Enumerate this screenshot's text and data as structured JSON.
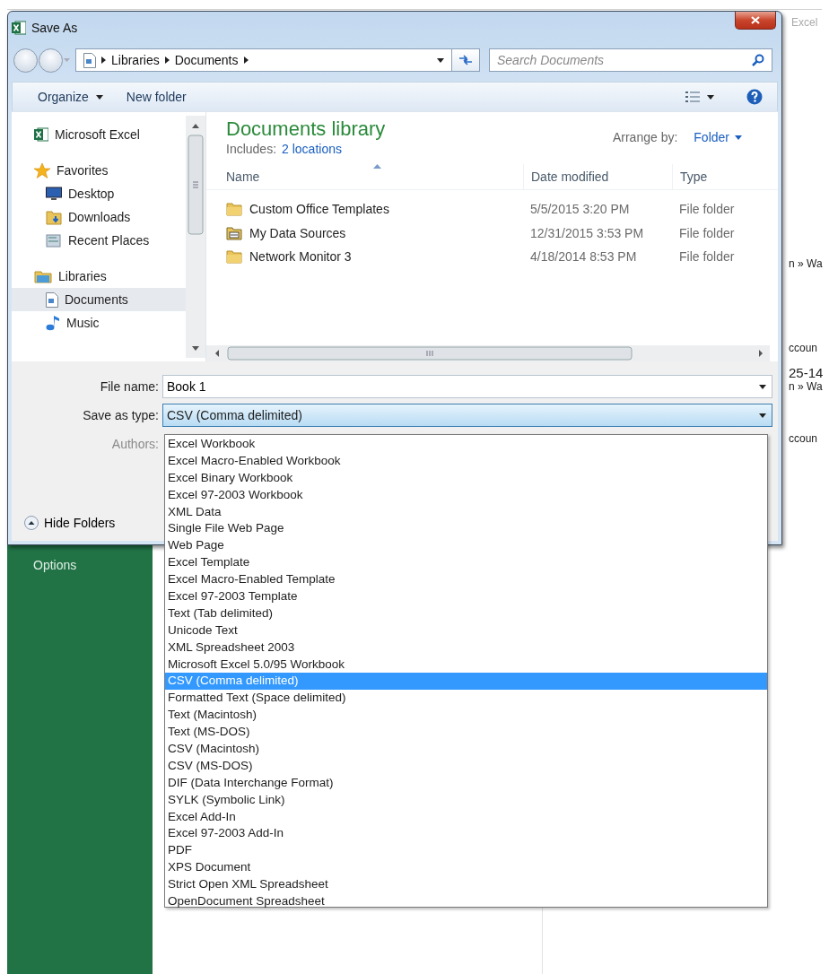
{
  "background": {
    "title_fragment": "Excel",
    "sidebar_items": [
      "Options"
    ],
    "fragments": [
      {
        "text": "n » Wa",
        "kind": "small"
      },
      {
        "text": "ccoun",
        "kind": "small"
      },
      {
        "text": "25-14",
        "kind": "large"
      },
      {
        "text": "n » Wa",
        "kind": "small"
      },
      {
        "text": "ccoun",
        "kind": "small"
      }
    ]
  },
  "dialog": {
    "title": "Save As",
    "breadcrumb": [
      "Libraries",
      "Documents"
    ],
    "search": {
      "placeholder": "Search Documents"
    },
    "toolbar": [
      {
        "label": "Organize",
        "menu": true
      },
      {
        "label": "New folder",
        "menu": false
      }
    ],
    "nav": [
      {
        "label": "Microsoft Excel",
        "kind": "excel",
        "selected": false
      },
      {
        "label": "Favorites",
        "kind": "star",
        "selected": false,
        "children": [
          {
            "label": "Desktop",
            "kind": "desktop",
            "selected": false
          },
          {
            "label": "Downloads",
            "kind": "downloads",
            "selected": false
          },
          {
            "label": "Recent Places",
            "kind": "recent",
            "selected": false
          }
        ]
      },
      {
        "label": "Libraries",
        "kind": "library",
        "selected": false,
        "children": [
          {
            "label": "Documents",
            "kind": "document",
            "selected": true
          },
          {
            "label": "Music",
            "kind": "music",
            "selected": false
          }
        ]
      }
    ],
    "library": {
      "title": "Documents library",
      "includes_label": "Includes:",
      "includes_link": "2 locations",
      "arrange_label": "Arrange by:",
      "arrange_value": "Folder"
    },
    "columns": [
      "Name",
      "Date modified",
      "Type"
    ],
    "files": [
      {
        "name": "Custom Office Templates",
        "date": "5/5/2015 3:20 PM",
        "type": "File folder",
        "kind": "folder"
      },
      {
        "name": "My Data Sources",
        "date": "12/31/2015 3:53 PM",
        "type": "File folder",
        "kind": "datafolder"
      },
      {
        "name": "Network Monitor 3",
        "date": "4/18/2014 8:53 PM",
        "type": "File folder",
        "kind": "folder"
      }
    ],
    "file_name": {
      "label": "File name:",
      "value": "Book 1"
    },
    "save_type": {
      "label": "Save as type:",
      "value": "CSV (Comma delimited)",
      "expanded": true
    },
    "authors": {
      "label": "Authors:",
      "disabled": true
    },
    "hide_folders": "Hide Folders",
    "type_options": [
      {
        "label": "Excel Workbook",
        "selected": false
      },
      {
        "label": "Excel Macro-Enabled Workbook",
        "selected": false
      },
      {
        "label": "Excel Binary Workbook",
        "selected": false
      },
      {
        "label": "Excel 97-2003 Workbook",
        "selected": false
      },
      {
        "label": "XML Data",
        "selected": false
      },
      {
        "label": "Single File Web Page",
        "selected": false
      },
      {
        "label": "Web Page",
        "selected": false
      },
      {
        "label": "Excel Template",
        "selected": false
      },
      {
        "label": "Excel Macro-Enabled Template",
        "selected": false
      },
      {
        "label": "Excel 97-2003 Template",
        "selected": false
      },
      {
        "label": "Text (Tab delimited)",
        "selected": false
      },
      {
        "label": "Unicode Text",
        "selected": false
      },
      {
        "label": "XML Spreadsheet 2003",
        "selected": false
      },
      {
        "label": "Microsoft Excel 5.0/95 Workbook",
        "selected": false
      },
      {
        "label": "CSV (Comma delimited)",
        "selected": true
      },
      {
        "label": "Formatted Text (Space delimited)",
        "selected": false
      },
      {
        "label": "Text (Macintosh)",
        "selected": false
      },
      {
        "label": "Text (MS-DOS)",
        "selected": false
      },
      {
        "label": "CSV (Macintosh)",
        "selected": false
      },
      {
        "label": "CSV (MS-DOS)",
        "selected": false
      },
      {
        "label": "DIF (Data Interchange Format)",
        "selected": false
      },
      {
        "label": "SYLK (Symbolic Link)",
        "selected": false
      },
      {
        "label": "Excel Add-In",
        "selected": false
      },
      {
        "label": "Excel 97-2003 Add-In",
        "selected": false
      },
      {
        "label": "PDF",
        "selected": false
      },
      {
        "label": "XPS Document",
        "selected": false
      },
      {
        "label": "Strict Open XML Spreadsheet",
        "selected": false
      },
      {
        "label": "OpenDocument Spreadsheet",
        "selected": false
      }
    ]
  }
}
